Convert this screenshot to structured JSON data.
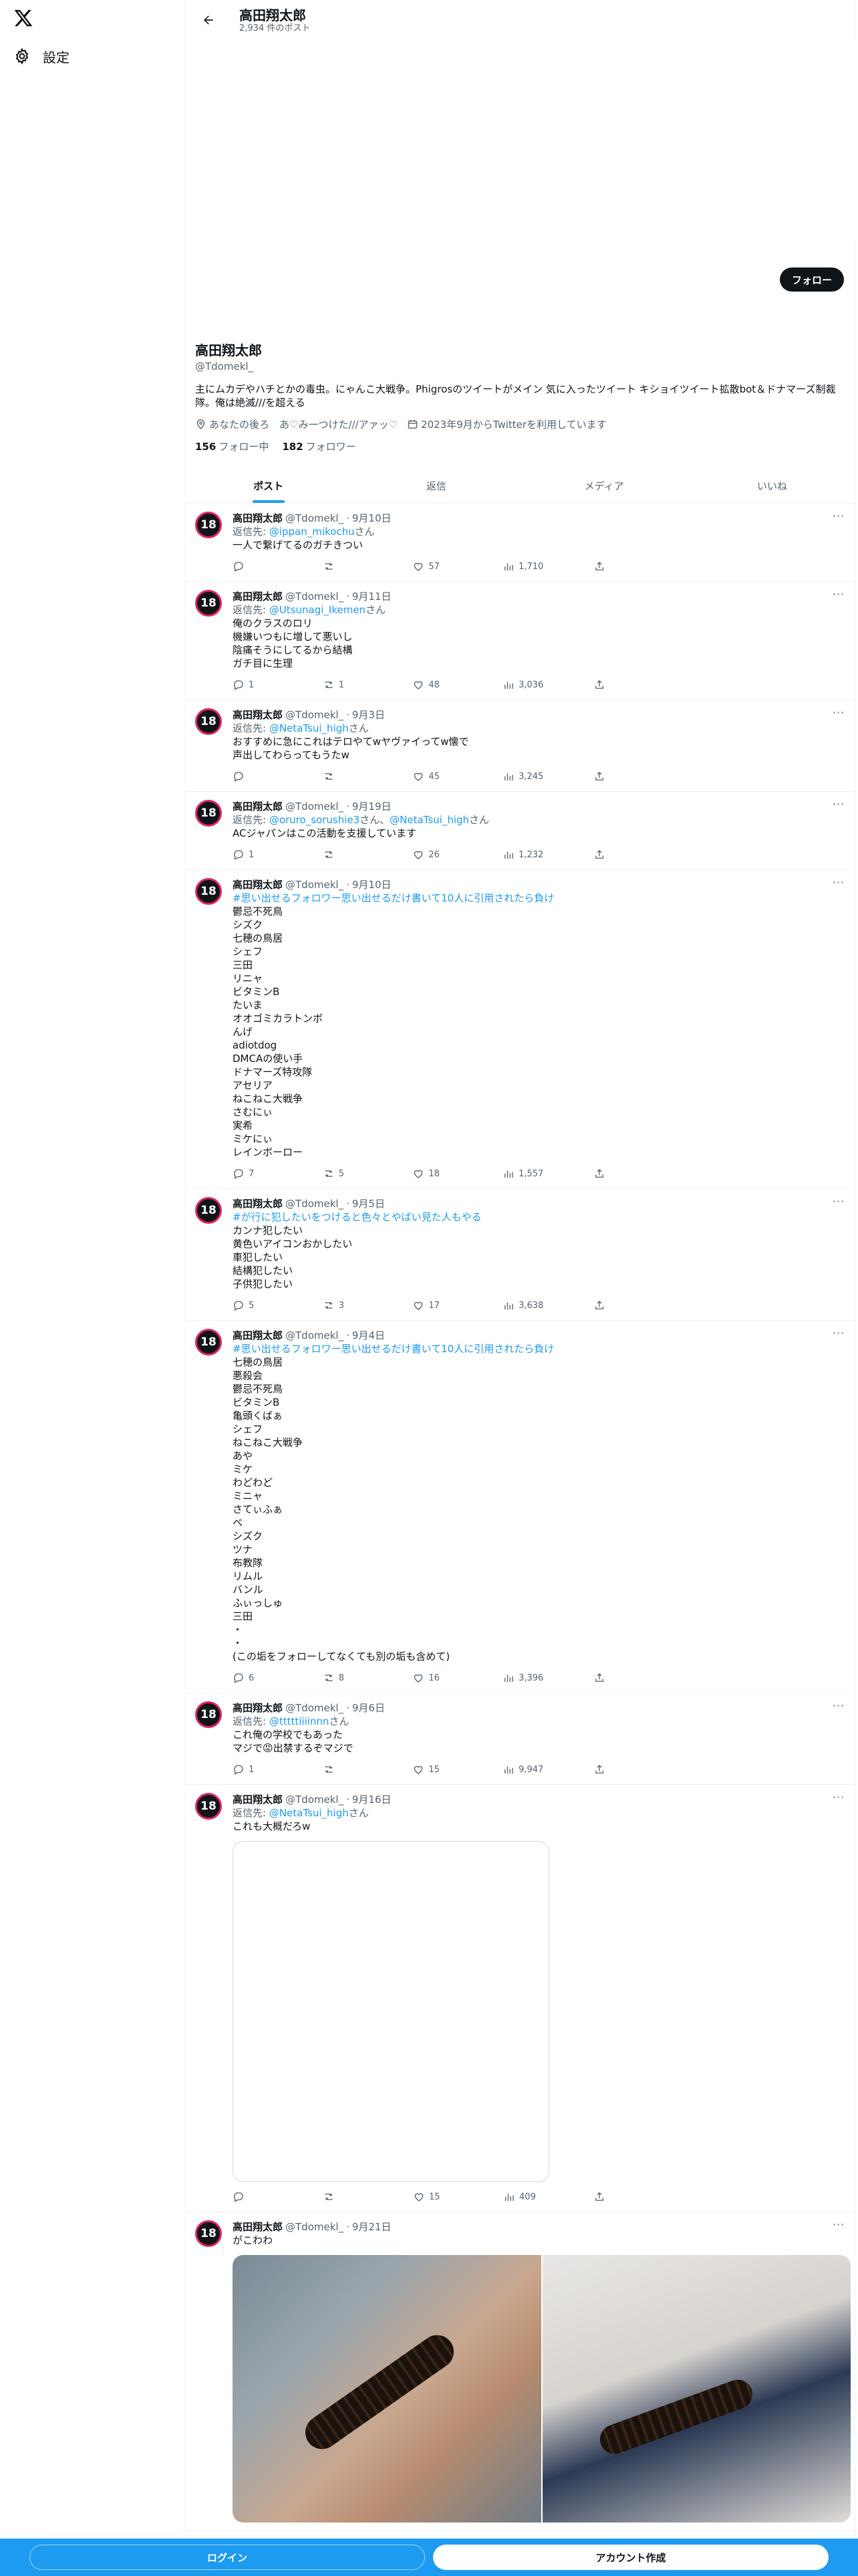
{
  "nav": {
    "settings_label": "設定",
    "logo_icon": "x-logo-icon",
    "settings_icon": "gear-icon"
  },
  "header": {
    "name": "高田翔太郎",
    "post_count": "2,934 件のポスト"
  },
  "profile": {
    "follow_label": "フォロー",
    "name": "高田翔太郎",
    "handle": "@Tdomekl_",
    "bio": "主にムカデやハチとかの毒虫。にゃんこ大戦争。Phigrosのツイートがメイン 気に入ったツイート キショイツイート拡散bot＆ドナマーズ制裁隊。俺は絶滅///を超える",
    "location": "あなたの後ろ　あ♡み一つけた///アァッ♡",
    "joined": "2023年9月からTwitterを利用しています",
    "following_count": "156",
    "following_label": "フォロー中",
    "followers_count": "182",
    "followers_label": "フォロワー"
  },
  "tabs": [
    {
      "label": "ポスト",
      "active": true
    },
    {
      "label": "返信",
      "active": false
    },
    {
      "label": "メディア",
      "active": false
    },
    {
      "label": "いいね",
      "active": false
    }
  ],
  "avatar_text": "18",
  "tweets": [
    {
      "name": "高田翔太郎",
      "handle": "@Tdomekl_",
      "date": "9月10日",
      "reply_prefix": "返信先: ",
      "reply_to": "@ippan_mikochu",
      "reply_suffix": "さん",
      "body": "一人で繋げてるのガチきつい",
      "replies": "",
      "retweets": "",
      "likes": "57",
      "views": "1,710"
    },
    {
      "name": "高田翔太郎",
      "handle": "@Tdomekl_",
      "date": "9月11日",
      "reply_prefix": "返信先: ",
      "reply_to": "@Utsunagi_Ikemen",
      "reply_suffix": "さん",
      "body": "俺のクラスのロリ\n機嫌いつもに増して悪いし\n陰痛そうにしてるから結構\nガチ目に生理",
      "replies": "1",
      "retweets": "1",
      "likes": "48",
      "views": "3,036"
    },
    {
      "name": "高田翔太郎",
      "handle": "@Tdomekl_",
      "date": "9月3日",
      "reply_prefix": "返信先: ",
      "reply_to": "@NetaTsui_high",
      "reply_suffix": "さん",
      "body": "おすすめに急にこれはテロやてwヤヴァイってw懐で\n声出してわらってもうたw",
      "replies": "",
      "retweets": "",
      "likes": "45",
      "views": "3,245"
    },
    {
      "name": "高田翔太郎",
      "handle": "@Tdomekl_",
      "date": "9月19日",
      "reply_prefix": "返信先: ",
      "reply_to": "@oruro_sorushie3",
      "reply_mid": "さん、",
      "reply_to2": "@NetaTsui_high",
      "reply_suffix": "さん",
      "body": "ACジャパンはこの活動を支援しています",
      "replies": "1",
      "retweets": "",
      "likes": "26",
      "views": "1,232"
    },
    {
      "name": "高田翔太郎",
      "handle": "@Tdomekl_",
      "date": "9月10日",
      "hashtag": "#思い出せるフォロワー思い出せるだけ書いて10人に引用されたら負け",
      "body": "鬱忌不死鳥\nシズク\n七穂の鳥居\nシェフ\n三田\nリニャ\nビタミンB\nたいま\nオオゴミカラトンボ\nんげ\nadiotdog\nDMCAの使い手\nドナマーズ特攻隊\nアセリア\nねこねこ大戦争\nさむにぃ\n実希\nミケにぃ\nレインボーロー",
      "replies": "7",
      "retweets": "5",
      "likes": "18",
      "views": "1,557"
    },
    {
      "name": "高田翔太郎",
      "handle": "@Tdomekl_",
      "date": "9月5日",
      "hashtag": "#が行に犯したいをつけると色々とやばい見た人もやる",
      "body": "カンナ犯したい\n黄色いアイコンおかしたい\n車犯したい\n結構犯したい\n子供犯したい",
      "replies": "5",
      "retweets": "3",
      "likes": "17",
      "views": "3,638"
    },
    {
      "name": "高田翔太郎",
      "handle": "@Tdomekl_",
      "date": "9月4日",
      "hashtag": "#思い出せるフォロワー思い出せるだけ書いて10人に引用されたら負け",
      "body": "七穂の鳥居\n悪殺会\n鬱忌不死鳥\nビタミンB\n亀頭くばぁ\nシェフ\nねこねこ大戦争\nあや\nミケ\nわどわど\nミニャ\nさてぃふぁ\nベ\nシズク\nツナ\n布教隊\nリムル\nバンル\nふぃっしゅ\n三田\n・\n・\n(この垢をフォローしてなくても別の垢も含めて)",
      "replies": "6",
      "retweets": "8",
      "likes": "16",
      "views": "3,396"
    },
    {
      "name": "高田翔太郎",
      "handle": "@Tdomekl_",
      "date": "9月6日",
      "reply_prefix": "返信先: ",
      "reply_to": "@tttttiiiinnn",
      "reply_suffix": "さん",
      "body": "これ俺の学校でもあった\nマジで😡出禁するぞマジで",
      "replies": "1",
      "retweets": "",
      "likes": "15",
      "views": "9,947"
    },
    {
      "name": "高田翔太郎",
      "handle": "@Tdomekl_",
      "date": "9月16日",
      "reply_prefix": "返信先: ",
      "reply_to": "@NetaTsui_high",
      "reply_suffix": "さん",
      "body": "これも大概だろw",
      "media": true,
      "replies": "",
      "retweets": "",
      "likes": "15",
      "views": "409"
    },
    {
      "name": "高田翔太郎",
      "handle": "@Tdomekl_",
      "date": "9月21日",
      "body": "がこわわ",
      "photos": true
    }
  ],
  "bottom": {
    "login": "ログイン",
    "signup": "アカウント作成"
  }
}
